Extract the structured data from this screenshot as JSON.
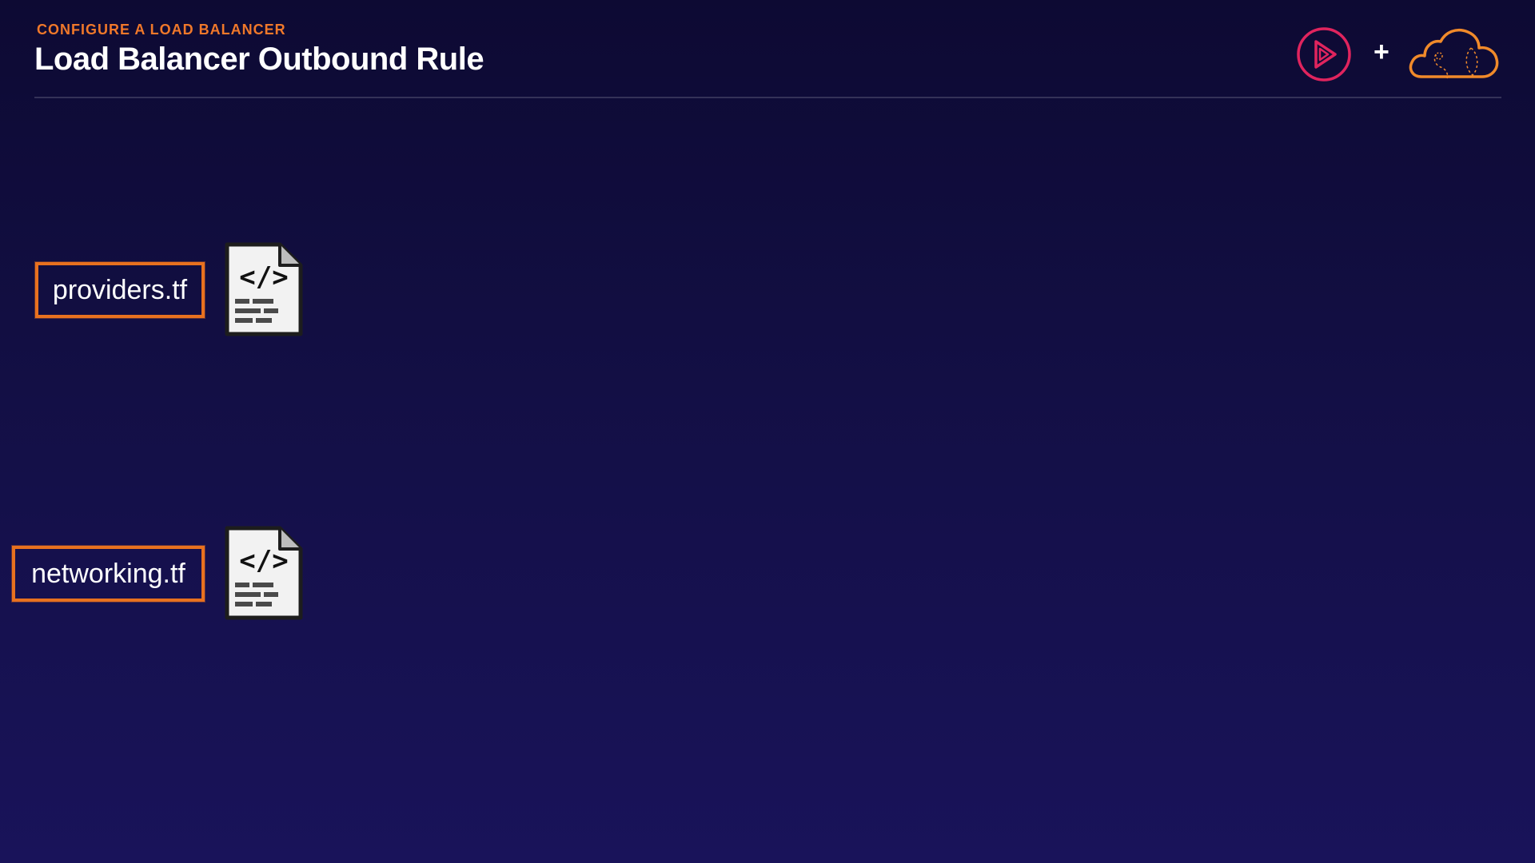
{
  "header": {
    "eyebrow": "CONFIGURE A LOAD BALANCER",
    "title": "Load Balancer Outbound Rule"
  },
  "logos": {
    "play_icon": "play-logo-icon",
    "plus": "+",
    "cloud_icon": "cloud-logo-icon"
  },
  "files": [
    {
      "label": "providers.tf",
      "icon": "code-file-icon"
    },
    {
      "label": "networking.tf",
      "icon": "code-file-icon"
    }
  ],
  "colors": {
    "accent_orange": "#e8711f",
    "play_logo_pink": "#e0245e",
    "background_top": "#0d0a33",
    "background_bottom": "#19135a"
  }
}
